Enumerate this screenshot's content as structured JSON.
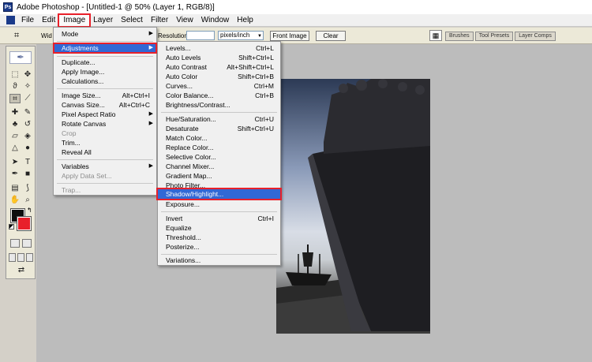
{
  "window": {
    "title": "Adobe Photoshop - [Untitled-1 @ 50% (Layer 1, RGB/8)]",
    "logo": "Ps"
  },
  "menubar": {
    "items": [
      {
        "label": "File"
      },
      {
        "label": "Edit"
      },
      {
        "label": "Image"
      },
      {
        "label": "Layer"
      },
      {
        "label": "Select"
      },
      {
        "label": "Filter"
      },
      {
        "label": "View"
      },
      {
        "label": "Window"
      },
      {
        "label": "Help"
      }
    ],
    "active": "Image"
  },
  "options": {
    "width_label": "Wid",
    "resolution_label": "Resolution:",
    "resolution_value": "",
    "unit": "pixels/inch",
    "front_image_button": "Front Image",
    "clear_button": "Clear",
    "wells": [
      {
        "label": "Brushes"
      },
      {
        "label": "Tool Presets"
      },
      {
        "label": "Layer Comps"
      }
    ]
  },
  "toolbox": {
    "foreground_color": "#0e0e0e",
    "background_color": "#e8202a"
  },
  "image_menu": {
    "items": [
      {
        "label": "Mode",
        "submenu": true
      },
      {
        "label": "Adjustments",
        "submenu": true,
        "highlight": true
      },
      {
        "label": "Duplicate..."
      },
      {
        "label": "Apply Image..."
      },
      {
        "label": "Calculations..."
      },
      {
        "label": "Image Size...",
        "shortcut": "Alt+Ctrl+I"
      },
      {
        "label": "Canvas Size...",
        "shortcut": "Alt+Ctrl+C"
      },
      {
        "label": "Pixel Aspect Ratio",
        "submenu": true
      },
      {
        "label": "Rotate Canvas",
        "submenu": true
      },
      {
        "label": "Crop",
        "disabled": true
      },
      {
        "label": "Trim..."
      },
      {
        "label": "Reveal All"
      },
      {
        "label": "Variables",
        "submenu": true
      },
      {
        "label": "Apply Data Set...",
        "disabled": true
      },
      {
        "label": "Trap...",
        "disabled": true
      }
    ]
  },
  "adjust_menu": {
    "items": [
      {
        "label": "Levels...",
        "shortcut": "Ctrl+L"
      },
      {
        "label": "Auto Levels",
        "shortcut": "Shift+Ctrl+L"
      },
      {
        "label": "Auto Contrast",
        "shortcut": "Alt+Shift+Ctrl+L"
      },
      {
        "label": "Auto Color",
        "shortcut": "Shift+Ctrl+B"
      },
      {
        "label": "Curves...",
        "shortcut": "Ctrl+M"
      },
      {
        "label": "Color Balance...",
        "shortcut": "Ctrl+B"
      },
      {
        "label": "Brightness/Contrast..."
      },
      {
        "label": "Hue/Saturation...",
        "shortcut": "Ctrl+U"
      },
      {
        "label": "Desaturate",
        "shortcut": "Shift+Ctrl+U"
      },
      {
        "label": "Match Color..."
      },
      {
        "label": "Replace Color..."
      },
      {
        "label": "Selective Color..."
      },
      {
        "label": "Channel Mixer..."
      },
      {
        "label": "Gradient Map..."
      },
      {
        "label": "Photo Filter..."
      },
      {
        "label": "Shadow/Highlight...",
        "highlight": true
      },
      {
        "label": "Exposure..."
      },
      {
        "label": "Invert",
        "shortcut": "Ctrl+I"
      },
      {
        "label": "Equalize"
      },
      {
        "label": "Threshold..."
      },
      {
        "label": "Posterize..."
      },
      {
        "label": "Variations..."
      }
    ]
  },
  "accent_colors": {
    "highlight": "#3168d5",
    "callout": "#e8202a"
  }
}
